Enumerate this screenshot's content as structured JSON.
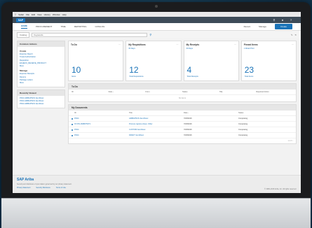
{
  "menubar": {
    "apple": "",
    "items": [
      "Safari",
      "File",
      "Edit",
      "View",
      "History",
      "Window",
      "Help"
    ],
    "right": ""
  },
  "shell": {
    "logo": "SAP",
    "user": ""
  },
  "nav": {
    "tabs": [
      "HOME",
      "PROCUREMENT",
      "TIME",
      "REPORTING",
      "CATALOG"
    ],
    "right": [
      "Recent",
      "Manage"
    ],
    "create": "Create"
  },
  "search": {
    "scope": "Catalog",
    "placeholder": "Keywords"
  },
  "left": {
    "common_actions": "Common Actions",
    "create_label": "Create",
    "create_items": [
      "Expense Report",
      "Travel Authorization",
      "Requisition",
      "ECHECK_RECEIVE_PRODUCT",
      "More"
    ],
    "manage_label": "Manage",
    "manage_items": [
      "Expense Receipts",
      "Returns",
      "Package Letters",
      "More"
    ],
    "recently_viewed": "Recently Viewed",
    "recent_items": [
      "PR14 ARIBAPSCN Item/Desc",
      "PR14 ARIBAPSCN Item/Desc",
      "PR14 ARIBAPSCN Item/Desc"
    ]
  },
  "tiles": [
    {
      "title": "To Do",
      "sub": "",
      "value": "10",
      "label": "Items"
    },
    {
      "title": "My Requisitions",
      "sub": "30 Days",
      "value": "12",
      "label": "Total Requisitions"
    },
    {
      "title": "My Receipts",
      "sub": "30 Days",
      "value": "4",
      "label": "Total Receipts"
    },
    {
      "title": "Pinned Items",
      "sub": "1 Week Prior",
      "value": "23",
      "label": "Total Items"
    }
  ],
  "todo": {
    "title": "To Do",
    "columns": [
      "ID",
      "Date ↓",
      "From",
      "Status",
      "Title",
      "Required Action"
    ],
    "empty": "No items"
  },
  "documents": {
    "title": "My Documents",
    "columns": [
      "ID",
      "Title",
      "Date ↓",
      "Status"
    ],
    "rows": [
      {
        "id": "PR14",
        "title": "ARIBAPSCN Item/Desc",
        "date": "7/18/2016",
        "status": "Composing"
      },
      {
        "id": "ST-PD-1698675373",
        "title": "Procure capture sheet, Other",
        "date": "7/18/2016",
        "status": "Composing"
      },
      {
        "id": "PR14",
        "title": "CUSTOM Item/Desc",
        "date": "7/18/2016",
        "status": "Composing"
      },
      {
        "id": "PR14",
        "title": "DRAFT Item/Desc",
        "date": "7/18/2016",
        "status": "Composing"
      }
    ],
    "pager": "1 2 3 >"
  },
  "footer": {
    "brand": "SAP Ariba",
    "brand_mark": "",
    "text": "Security and disclosure of your data is governed by our privacy statement.",
    "links": [
      "Privacy Statement",
      "Security Disclosure",
      "Terms of Use"
    ],
    "copy": "© 1996–2016 Ariba, Inc. All rights reserved."
  }
}
